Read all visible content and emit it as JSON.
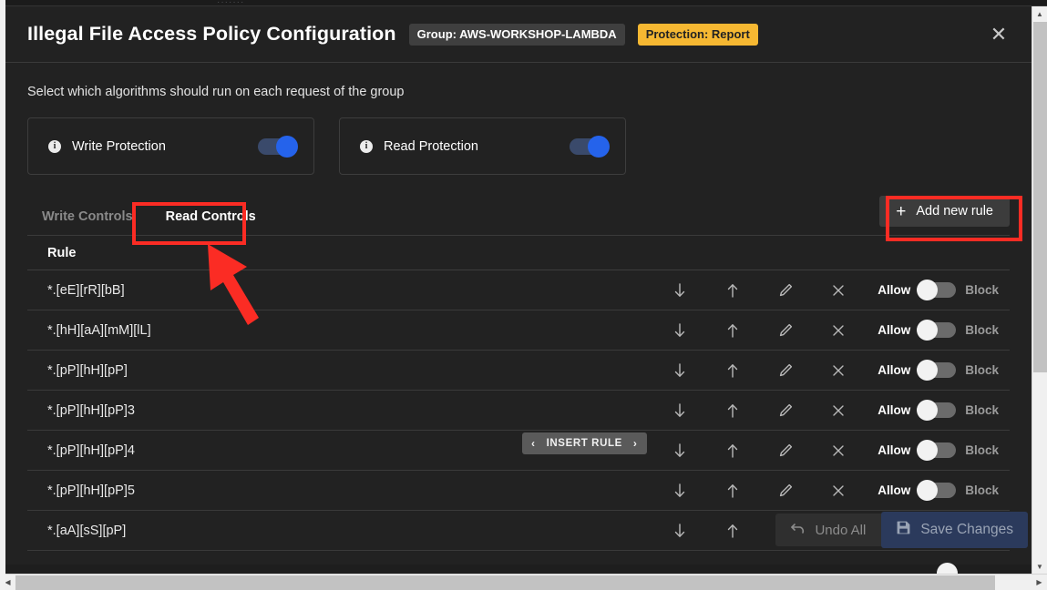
{
  "background": {
    "behind_text": "·······"
  },
  "header": {
    "title": "Illegal File Access Policy Configuration",
    "group_badge": "Group: AWS-WORKSHOP-LAMBDA",
    "protection_badge": "Protection: Report",
    "close_label": "✕",
    "colors": {
      "group_badge_bg": "#3f3f3f",
      "protection_badge_bg": "#f6b832"
    }
  },
  "body": {
    "subtitle": "Select which algorithms should run on each request of the group",
    "protections": [
      {
        "label": "Write Protection",
        "info": "i",
        "enabled": true
      },
      {
        "label": "Read Protection",
        "info": "i",
        "enabled": true
      }
    ]
  },
  "tabs": [
    {
      "label": "Write Controls",
      "active": false
    },
    {
      "label": "Read Controls",
      "active": true
    }
  ],
  "add_rule_button": {
    "label": "Add new rule",
    "plus": "+"
  },
  "table": {
    "column_header": "Rule",
    "allow_label": "Allow",
    "block_label": "Block",
    "rows": [
      {
        "pattern": "*.[eE][rR][bB]",
        "state": "allow"
      },
      {
        "pattern": "*.[hH][aA][mM][lL]",
        "state": "allow"
      },
      {
        "pattern": "*.[pP][hH][pP]",
        "state": "allow"
      },
      {
        "pattern": "*.[pP][hH][pP]3",
        "state": "allow"
      },
      {
        "pattern": "*.[pP][hH][pP]4",
        "state": "allow"
      },
      {
        "pattern": "*.[pP][hH][pP]5",
        "state": "allow"
      },
      {
        "pattern": "*.[aA][sS][pP]",
        "state": "allow"
      }
    ],
    "row_actions": [
      "move-down",
      "move-up",
      "edit",
      "delete"
    ]
  },
  "insert_rule": {
    "left_chevron": "‹",
    "label": "INSERT RULE",
    "right_chevron": "›"
  },
  "footer": {
    "undo_label": "Undo All",
    "save_label": "Save Changes"
  },
  "annotations": {
    "tab_highlight": "Read Controls",
    "button_highlight": "Add new rule",
    "arrow_color": "#fb2c24"
  },
  "scrollbars": {
    "vertical": {
      "up": "▲",
      "down": "▼"
    },
    "horizontal": {
      "left": "◀",
      "right": "▶"
    }
  }
}
